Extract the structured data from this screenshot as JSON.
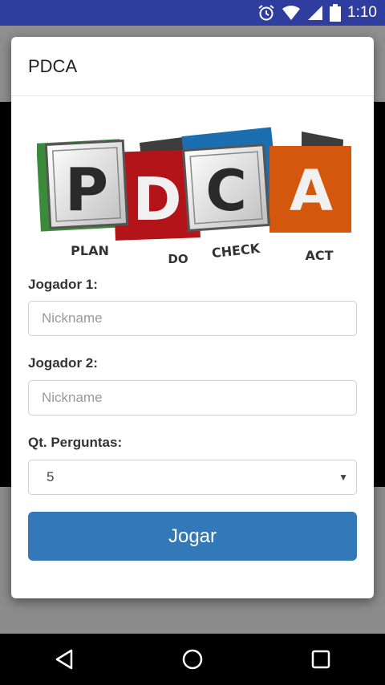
{
  "status_bar": {
    "time": "1:10",
    "icons": [
      "alarm-icon",
      "wifi-icon",
      "signal-icon",
      "battery-icon"
    ]
  },
  "dialog": {
    "title": "PDCA",
    "logo": {
      "letters": [
        "P",
        "D",
        "C",
        "A"
      ],
      "words": [
        "PLAN",
        "DO",
        "CHECK",
        "ACT"
      ],
      "colors": {
        "plan": "#3a8c3a",
        "do": "#b3141a",
        "check": "#1b6fb1",
        "act": "#d3580d"
      }
    },
    "player1": {
      "label": "Jogador 1:",
      "placeholder": "Nickname",
      "value": ""
    },
    "player2": {
      "label": "Jogador 2:",
      "placeholder": "Nickname",
      "value": ""
    },
    "questions": {
      "label": "Qt. Perguntas:",
      "selected": "5"
    },
    "submit_label": "Jogar"
  },
  "colors": {
    "status_bar": "#2f3e9e",
    "primary_button": "#3379b7"
  },
  "nav_bar": {
    "icons": [
      "back-icon",
      "home-icon",
      "recents-icon"
    ]
  }
}
